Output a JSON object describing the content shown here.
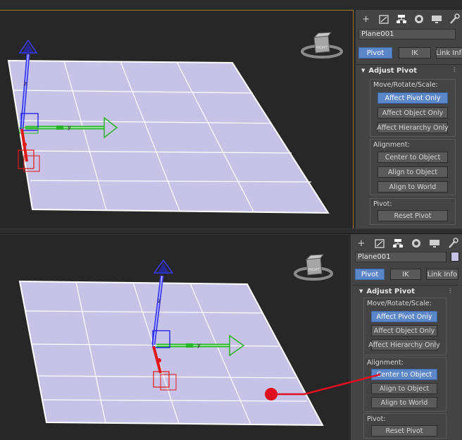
{
  "colors": {
    "accent_active": "#5b87c9",
    "plane_fill": "#c6c3e6",
    "annotation": "#e01020"
  },
  "command_panel_icons": [
    "create-icon",
    "modify-icon",
    "hierarchy-icon",
    "motion-icon",
    "display-icon",
    "utilities-icon"
  ],
  "viewcube": {
    "label": "RIGHT"
  },
  "gizmo": {
    "z_label": "z",
    "y_label": "y"
  },
  "top_panel": {
    "object_name": "Plane001",
    "modes": [
      "Pivot",
      "IK",
      "Link Info"
    ],
    "rollout_title": "Adjust Pivot",
    "move_group": {
      "label": "Move/Rotate/Scale:",
      "buttons": [
        "Affect Pivot Only",
        "Affect Object Only",
        "Affect Hierarchy Only"
      ]
    },
    "alignment_group": {
      "label": "Alignment:",
      "buttons": [
        "Center to Object",
        "Align to Object",
        "Align to World"
      ]
    },
    "pivot_group": {
      "label": "Pivot:",
      "buttons": [
        "Reset Pivot"
      ]
    }
  },
  "bottom_panel": {
    "object_name": "Plane001",
    "modes": [
      "Pivot",
      "IK",
      "Link Info"
    ],
    "rollout_title": "Adjust Pivot",
    "move_group": {
      "label": "Move/Rotate/Scale:",
      "buttons": [
        "Affect Pivot Only",
        "Affect Object Only",
        "Affect Hierarchy Only"
      ]
    },
    "alignment_group": {
      "label": "Alignment:",
      "buttons": [
        "Center to Object",
        "Align to Object",
        "Align to World"
      ]
    },
    "pivot_group": {
      "label": "Pivot:",
      "buttons": [
        "Reset Pivot"
      ]
    }
  }
}
